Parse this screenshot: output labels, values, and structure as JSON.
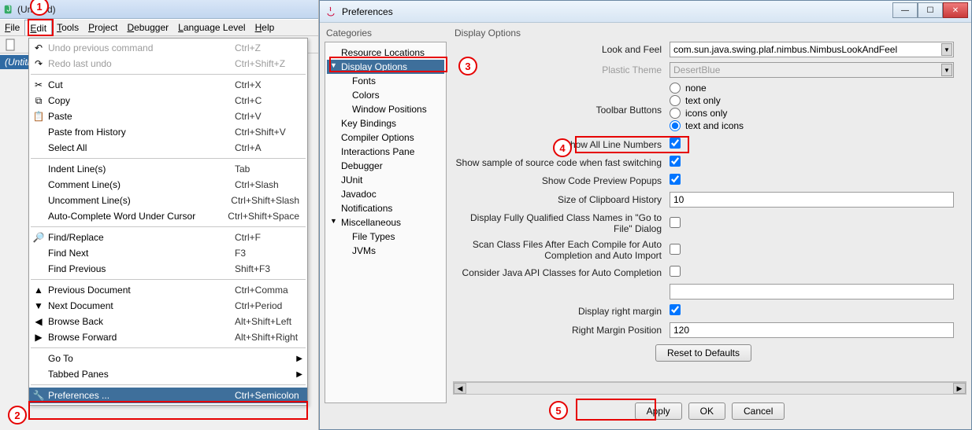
{
  "app": {
    "title": "(Untitled)"
  },
  "side_label": "(Untitled)",
  "menus": {
    "file": "File",
    "edit": "Edit",
    "tools": "Tools",
    "project": "Project",
    "debugger": "Debugger",
    "language_level": "Language Level",
    "help": "Help"
  },
  "edit_menu": {
    "undo": {
      "label": "Undo previous command",
      "accel": "Ctrl+Z"
    },
    "redo": {
      "label": "Redo last undo",
      "accel": "Ctrl+Shift+Z"
    },
    "cut": {
      "label": "Cut",
      "accel": "Ctrl+X"
    },
    "copy": {
      "label": "Copy",
      "accel": "Ctrl+C"
    },
    "paste": {
      "label": "Paste",
      "accel": "Ctrl+V"
    },
    "paste_history": {
      "label": "Paste from History",
      "accel": "Ctrl+Shift+V"
    },
    "select_all": {
      "label": "Select All",
      "accel": "Ctrl+A"
    },
    "indent": {
      "label": "Indent Line(s)",
      "accel": "Tab"
    },
    "comment": {
      "label": "Comment Line(s)",
      "accel": "Ctrl+Slash"
    },
    "uncomment": {
      "label": "Uncomment Line(s)",
      "accel": "Ctrl+Shift+Slash"
    },
    "autocomplete": {
      "label": "Auto-Complete Word Under Cursor",
      "accel": "Ctrl+Shift+Space"
    },
    "find": {
      "label": "Find/Replace",
      "accel": "Ctrl+F"
    },
    "find_next": {
      "label": "Find Next",
      "accel": "F3"
    },
    "find_prev": {
      "label": "Find Previous",
      "accel": "Shift+F3"
    },
    "prev_doc": {
      "label": "Previous Document",
      "accel": "Ctrl+Comma"
    },
    "next_doc": {
      "label": "Next Document",
      "accel": "Ctrl+Period"
    },
    "browse_back": {
      "label": "Browse Back",
      "accel": "Alt+Shift+Left"
    },
    "browse_fwd": {
      "label": "Browse Forward",
      "accel": "Alt+Shift+Right"
    },
    "goto": {
      "label": "Go To"
    },
    "tabbed": {
      "label": "Tabbed Panes"
    },
    "prefs": {
      "label": "Preferences ...",
      "accel": "Ctrl+Semicolon"
    }
  },
  "callouts": {
    "c1": "1",
    "c2": "2",
    "c3": "3",
    "c4": "4",
    "c5": "5"
  },
  "pref": {
    "title": "Preferences",
    "categories_header": "Categories",
    "options_header": "Display Options",
    "tree": {
      "resource": "Resource Locations",
      "display": "Display Options",
      "fonts": "Fonts",
      "colors": "Colors",
      "winpos": "Window Positions",
      "keybind": "Key Bindings",
      "compiler": "Compiler Options",
      "interactions": "Interactions Pane",
      "debugger": "Debugger",
      "junit": "JUnit",
      "javadoc": "Javadoc",
      "notifications": "Notifications",
      "misc": "Miscellaneous",
      "filetypes": "File Types",
      "jvms": "JVMs"
    },
    "labels": {
      "look_and_feel": "Look and Feel",
      "plastic": "Plastic Theme",
      "toolbar": "Toolbar Buttons",
      "show_line": "Show All Line Numbers",
      "show_sample": "Show sample of source code when fast switching",
      "show_popups": "Show Code Preview Popups",
      "clip_size": "Size of Clipboard History",
      "fqcn": "Display Fully Qualified Class Names in \"Go to File\" Dialog",
      "scan": "Scan Class Files After Each Compile for Auto Completion and Auto Import",
      "consider": "Consider Java API Classes for Auto Completion",
      "right_margin": "Display right margin",
      "right_pos": "Right Margin Position"
    },
    "values": {
      "look_and_feel": "com.sun.java.swing.plaf.nimbus.NimbusLookAndFeel",
      "plastic": "DesertBlue",
      "toolbar_options": {
        "none": "none",
        "text": "text only",
        "icons": "icons only",
        "both": "text and icons"
      },
      "toolbar_selected": "text and icons",
      "show_line": true,
      "show_sample": true,
      "show_popups": true,
      "clip_size": "10",
      "fqcn": false,
      "scan": false,
      "consider": false,
      "consider_text": "",
      "right_margin": true,
      "right_pos": "120"
    },
    "buttons": {
      "reset": "Reset to Defaults",
      "apply": "Apply",
      "ok": "OK",
      "cancel": "Cancel"
    }
  }
}
